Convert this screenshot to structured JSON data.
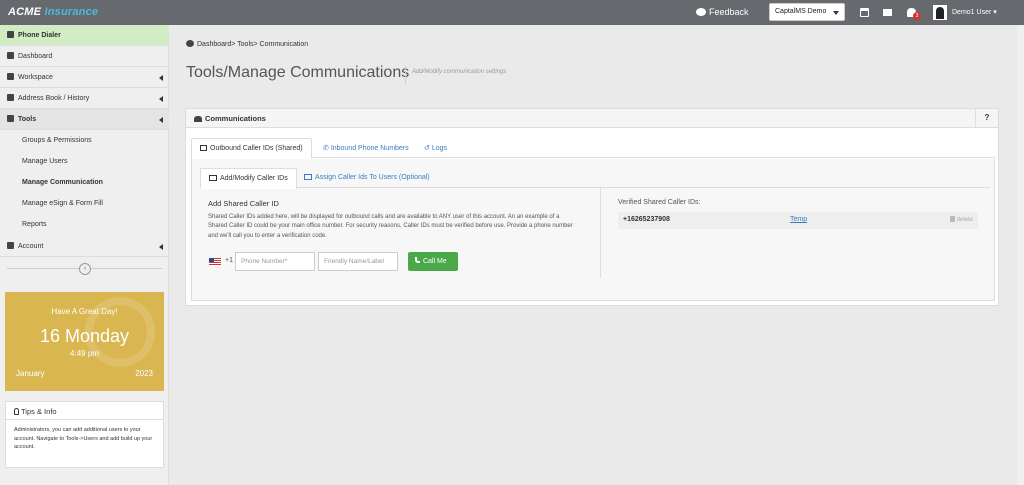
{
  "app": {
    "logo_main": "ACME",
    "logo_accent": "Insurance"
  },
  "header": {
    "feedback_label": "Feedback",
    "company_select": "CaptalMS Demo",
    "notification_count": "3",
    "user_name": "Demo1 User"
  },
  "sidebar": {
    "items": [
      {
        "label": "Phone Dialer"
      },
      {
        "label": "Dashboard"
      },
      {
        "label": "Workspace"
      },
      {
        "label": "Address Book / History"
      },
      {
        "label": "Tools"
      },
      {
        "label": "Account"
      }
    ],
    "tools_sub": [
      {
        "label": "Groups & Permissions"
      },
      {
        "label": "Manage Users"
      },
      {
        "label": "Manage Communication"
      },
      {
        "label": "Manage eSign & Form Fill"
      },
      {
        "label": "Reports"
      }
    ]
  },
  "date_widget": {
    "greeting": "Have A Great Day!",
    "day": "16 Monday",
    "time": "4:49 pm",
    "month": "January",
    "year": "2023"
  },
  "tips": {
    "title": "Tips & Info",
    "body": "Administrators, you can add additional users to your account. Navigate to Tools->Users and add build up your account."
  },
  "breadcrumb": {
    "home": "Dashboard",
    "tools": "Tools",
    "current": "Communication"
  },
  "page": {
    "title": "Tools/Manage Communications",
    "subtitle": "Add/Modify communication settings"
  },
  "panel": {
    "title": "Communications",
    "help": "?",
    "tabs": [
      {
        "label": "Outbound Caller IDs (Shared)"
      },
      {
        "label": "Inbound Phone Numbers"
      },
      {
        "label": "Logs"
      }
    ],
    "subtabs": [
      {
        "label": "Add/Modify Caller IDs"
      },
      {
        "label": "Assign Caller Ids To Users (Optional)"
      }
    ],
    "add": {
      "title": "Add Shared Caller ID",
      "description": "Shared Caller IDs added here, will be displayed for outbound calls and are available to ANY user of this account. An an example of a Shared Caller ID could be your main office number. For security reasons, Caller IDs must be verified before use. Provide a phone number and we'll call you to enter a verification code.",
      "country_code": "+1",
      "phone_placeholder": "Phone Number*",
      "name_placeholder": "Friendly Name/Label",
      "call_button": "Call Me"
    },
    "verified": {
      "label": "Verified Shared Caller IDs:",
      "rows": [
        {
          "number": "+16265237908",
          "name": "Temp",
          "action": "delete"
        }
      ]
    }
  },
  "colors": {
    "topbar": "#666a6e",
    "accent": "#4fb6e0",
    "active_nav": "#d2ecc4",
    "call_green": "#4ba849",
    "widget_gold": "#d9b650"
  }
}
